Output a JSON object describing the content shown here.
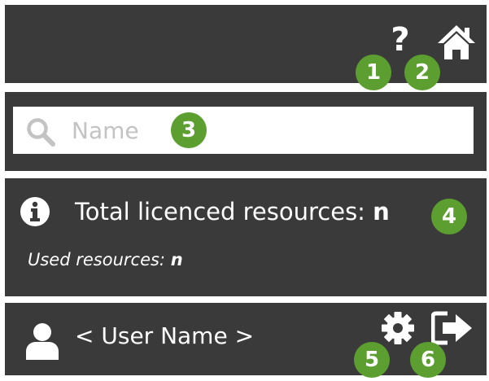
{
  "header": {
    "help_glyph": "?",
    "help_icon": "question-mark-icon",
    "home_icon": "home-icon"
  },
  "search": {
    "placeholder": "Name",
    "icon": "search-icon"
  },
  "info": {
    "icon": "info-icon",
    "total_label": "Total licenced resources:",
    "total_value": "n",
    "used_label": "Used resources:",
    "used_value": "n"
  },
  "user": {
    "icon": "user-icon",
    "name": "< User Name >",
    "settings_icon": "gear-icon",
    "logout_icon": "sign-out-icon"
  },
  "callouts": [
    "1",
    "2",
    "3",
    "4",
    "5",
    "6"
  ],
  "colors": {
    "panel": "#3a3a3a",
    "badge": "#5c9e2f",
    "text": "#ffffff",
    "placeholder": "#c3c3c3"
  }
}
